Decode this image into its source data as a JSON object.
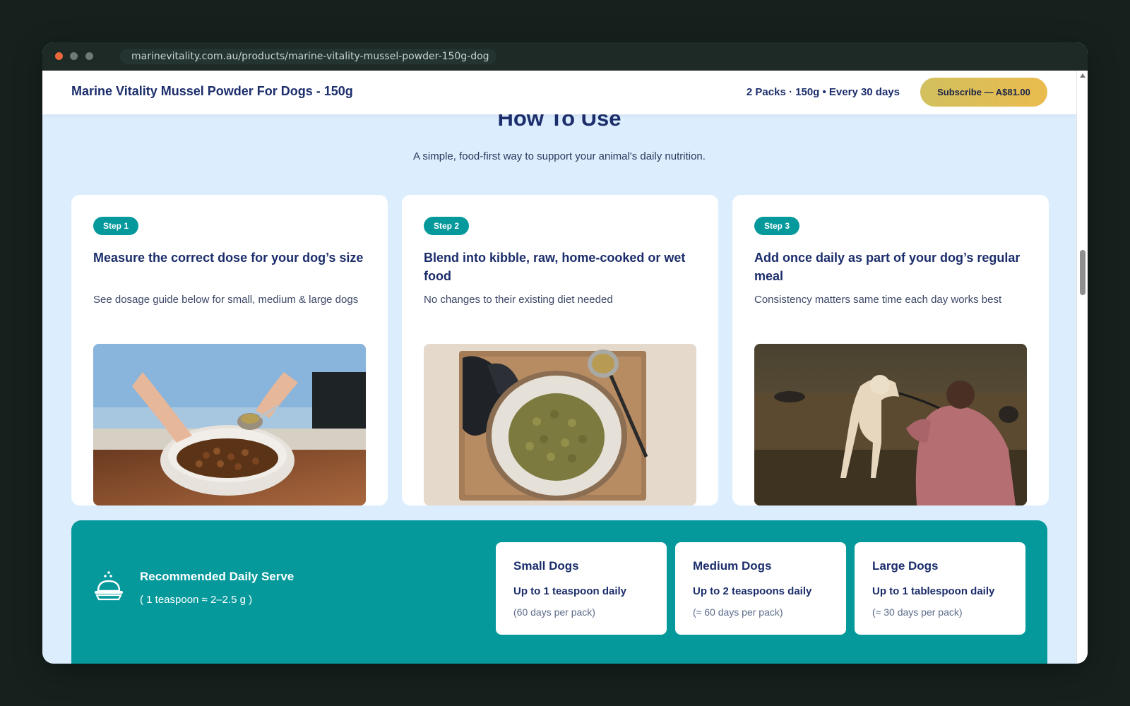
{
  "browser": {
    "url": "marinevitality.com.au/products/marine-vitality-mussel-powder-150g-dog"
  },
  "sticky_bar": {
    "product_title": "Marine Vitality Mussel Powder For Dogs - 150g",
    "variant_summary": "2 Packs · 150g • Every 30 days",
    "subscribe_label": "Subscribe — A$81.00",
    "subscribe_color": "#e0be55"
  },
  "how_to_use": {
    "title": "How To Use",
    "subtitle": "A simple, food-first way to support your animal's daily nutrition.",
    "steps": [
      {
        "badge": "Step 1",
        "title": "Measure the correct dose for your dog’s size",
        "description": "See dosage guide below for small, medium & large dogs",
        "image": "scooping-powder-into-dog-food-bowl"
      },
      {
        "badge": "Step 2",
        "title": "Blend into kibble, raw, home-cooked or wet food",
        "description": "No changes to their existing diet needed",
        "image": "kibble-bowl-with-mussels-and-spoon"
      },
      {
        "badge": "Step 3",
        "title": "Add once daily as part of your dog’s regular meal",
        "description": "Consistency matters same time each day works best",
        "image": "woman-with-dog-in-park"
      }
    ]
  },
  "daily_serve": {
    "icon": "dog-bowl-icon",
    "title": "Recommended Daily Serve",
    "note": "( 1 teaspoon ≈ 2–2.5 g )",
    "sizes": [
      {
        "name": "Small Dogs",
        "amount": "Up to 1 teaspoon daily",
        "duration": "(60 days per pack)"
      },
      {
        "name": "Medium Dogs",
        "amount": "Up to 2 teaspoons daily",
        "duration": "(≈ 60 days per pack)"
      },
      {
        "name": "Large Dogs",
        "amount": "Up to 1 tablespoon daily",
        "duration": "(≈ 30 days per pack)"
      }
    ]
  },
  "colors": {
    "teal": "#05999c",
    "navy": "#1b2d6b",
    "page_bg": "#dcedfd"
  }
}
